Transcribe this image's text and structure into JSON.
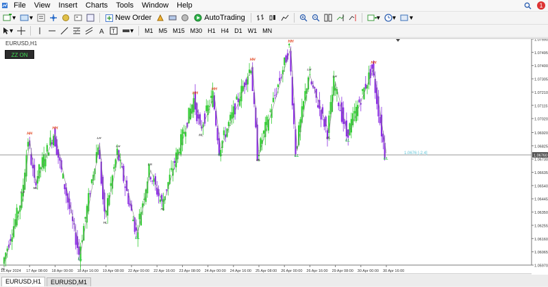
{
  "menu": {
    "items": [
      "File",
      "View",
      "Insert",
      "Charts",
      "Tools",
      "Window",
      "Help"
    ],
    "notification_count": "1"
  },
  "toolbar": {
    "new_order_label": "New Order",
    "autotrading_label": "AutoTrading"
  },
  "timeframes": [
    "M1",
    "M5",
    "M15",
    "M30",
    "H1",
    "H4",
    "D1",
    "W1",
    "MN"
  ],
  "chart": {
    "symbol_label": "EURUSD,H1",
    "zz_button": "ZZ ON",
    "current_price": "1.06760",
    "zz_readout": "1.0676 [-2.4]",
    "price_axis": [
      "1.07590",
      "1.07495",
      "1.07400",
      "1.07305",
      "1.07210",
      "1.07115",
      "1.07020",
      "1.06920",
      "1.06825",
      "1.06730",
      "1.06635",
      "1.06540",
      "1.06445",
      "1.06350",
      "1.06255",
      "1.06160",
      "1.06065",
      "1.05970"
    ],
    "time_axis": [
      "16 Apr 2024",
      "17 Apr 08:00",
      "18 Apr 00:00",
      "18 Apr 16:00",
      "19 Apr 08:00",
      "22 Apr 00:00",
      "22 Apr 16:00",
      "23 Apr 08:00",
      "24 Apr 00:00",
      "24 Apr 16:00",
      "25 Apr 08:00",
      "26 Apr 00:00",
      "26 Apr 16:00",
      "29 Apr 08:00",
      "30 Apr 00:00",
      "30 Apr 16:00"
    ],
    "colors": {
      "bull": "#32cd32",
      "bear": "#8a2be2",
      "hh": "#e2421c",
      "ll": "#1fc43c",
      "zigzag": "#808080",
      "price_line": "#5a5a5a",
      "readout": "#5ec5d8"
    }
  },
  "chart_data": {
    "type": "candlestick",
    "symbol": "EURUSD",
    "timeframe": "H1",
    "ylim": [
      1.0597,
      1.0759
    ],
    "current_price": 1.0676,
    "swing_points": [
      {
        "label": "HL",
        "x": "16 Apr 2024",
        "price": 1.0598
      },
      {
        "label": "LH",
        "x": "17 Apr 00:00",
        "price": 1.0645
      },
      {
        "label": "HH",
        "x": "17 Apr 08:00",
        "price": 1.0687
      },
      {
        "label": "ML",
        "x": "17 Apr 12:00",
        "price": 1.0656
      },
      {
        "label": "HH",
        "x": "18 Apr 00:00",
        "price": 1.0691
      },
      {
        "label": "LL",
        "x": "18 Apr 16:00",
        "price": 1.0605
      },
      {
        "label": "LH",
        "x": "19 Apr 04:00",
        "price": 1.0684
      },
      {
        "label": "HL",
        "x": "19 Apr 08:00",
        "price": 1.0631
      },
      {
        "label": "LH",
        "x": "19 Apr 16:00",
        "price": 1.0678
      },
      {
        "label": "LL",
        "x": "22 Apr 04:00",
        "price": 1.062
      },
      {
        "label": "LH",
        "x": "22 Apr 12:00",
        "price": 1.0665
      },
      {
        "label": "HL",
        "x": "22 Apr 20:00",
        "price": 1.0641
      },
      {
        "label": "HH",
        "x": "23 Apr 16:00",
        "price": 1.0716
      },
      {
        "label": "ML",
        "x": "23 Apr 20:00",
        "price": 1.0694
      },
      {
        "label": "HH",
        "x": "24 Apr 04:00",
        "price": 1.0719
      },
      {
        "label": "LL",
        "x": "24 Apr 08:00",
        "price": 1.068
      },
      {
        "label": "HH",
        "x": "25 Apr 04:00",
        "price": 1.074
      },
      {
        "label": "ML",
        "x": "25 Apr 08:00",
        "price": 1.0676
      },
      {
        "label": "HH",
        "x": "26 Apr 04:00",
        "price": 1.0753
      },
      {
        "label": "LL",
        "x": "26 Apr 08:00",
        "price": 1.0679
      },
      {
        "label": "LH",
        "x": "26 Apr 16:00",
        "price": 1.0733
      },
      {
        "label": "ML",
        "x": "29 Apr 04:00",
        "price": 1.0692
      },
      {
        "label": "LH",
        "x": "29 Apr 08:00",
        "price": 1.0728
      },
      {
        "label": "LL",
        "x": "29 Apr 16:00",
        "price": 1.069
      },
      {
        "label": "HH",
        "x": "30 Apr 08:00",
        "price": 1.0738
      },
      {
        "label": "LL",
        "x": "30 Apr 16:00",
        "price": 1.0677
      }
    ]
  }
}
